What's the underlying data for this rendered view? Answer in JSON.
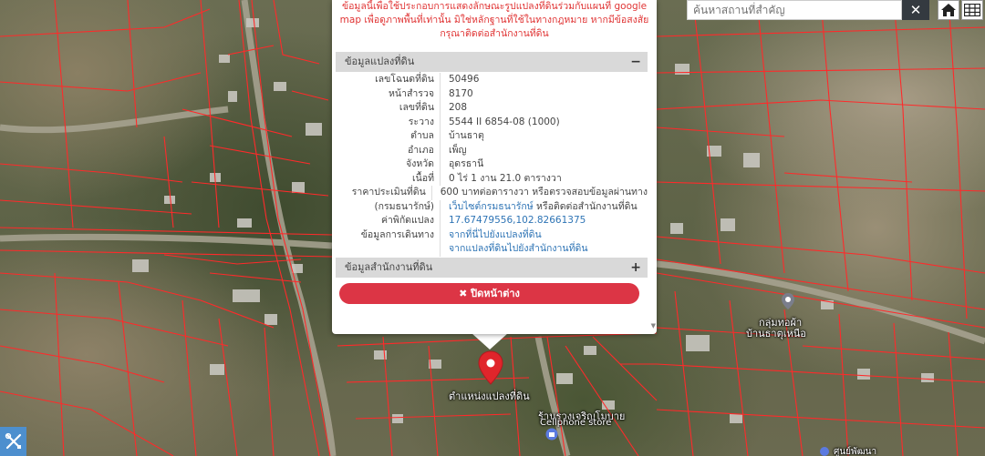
{
  "search": {
    "placeholder": "ค้นหาสถานที่สำคัญ"
  },
  "popup": {
    "notice": "ข้อมูลนี้เพื่อใช้ประกอบการแสดงลักษณะรูปแปลงที่ดินร่วมกับแผนที่ google map เพื่อดูภาพพื้นที่เท่านั้น มิใช่หลักฐานที่ใช้ในทางกฎหมาย หากมีข้อสงสัย กรุณาติดต่อสำนักงานที่ดิน",
    "section_parcel": "ข้อมูลแปลงที่ดิน",
    "section_parcel_toggle": "−",
    "rows": [
      {
        "label": "เลขโฉนดที่ดิน",
        "value": "50496"
      },
      {
        "label": "หน้าสำรวจ",
        "value": "8170"
      },
      {
        "label": "เลขที่ดิน",
        "value": "208"
      },
      {
        "label": "ระวาง",
        "value": "5544 II 6854-08 (1000)"
      },
      {
        "label": "ตำบล",
        "value": "บ้านธาตุ"
      },
      {
        "label": "อำเภอ",
        "value": "เพ็ญ"
      },
      {
        "label": "จังหวัด",
        "value": "อุดรธานี"
      },
      {
        "label": "เนื้อที่",
        "value": "0 ไร่ 1 งาน 21.0 ตารางวา"
      }
    ],
    "price_label_1": "ราคาประเมินที่ดิน",
    "price_label_2": "(กรมธนารักษ์)",
    "price_value_1": "600 บาทต่อตารางวา หรือตรวจสอบข้อมูลผ่านทาง",
    "price_link": "เว็บไซต์กรมธนารักษ์",
    "price_value_2": " หรือติดต่อสำนักงานที่ดิน",
    "coord_label": "ค่าพิกัดแปลง",
    "coord_value": "17.67479556,102.82661375",
    "travel_label": "ข้อมูลการเดินทาง",
    "travel_link_1": "จากที่นี่ไปยังแปลงที่ดิน",
    "travel_link_2": "จากแปลงที่ดินไปยังสำนักงานที่ดิน",
    "section_office": "ข้อมูลสำนักงานที่ดิน",
    "section_office_toggle": "+",
    "close_label": "ปิดหน้าต่าง"
  },
  "map": {
    "marker_label": "ตำแหน่งแปลงที่ดิน",
    "poi_1_line1": "ร้านรวงเจริญโมบาย",
    "poi_1_line2": "Cellphone store",
    "poi_2_line1": "กลุ่มทอผ้า",
    "poi_2_line2": "บ้านธาตุเหนือ",
    "poi_3": "ศูนย์พัฒนา"
  },
  "colors": {
    "marker": "#e0252b",
    "close_button": "#dc3545",
    "notice_text": "#e03434",
    "parcel_lines": "#ff2a2a",
    "link": "#2e74b5"
  },
  "icons": {
    "clear": "close-icon",
    "home": "home-icon",
    "grid": "grid-icon",
    "close_button": "close-icon",
    "tool": "tools-icon",
    "marker": "map-pin-icon"
  }
}
